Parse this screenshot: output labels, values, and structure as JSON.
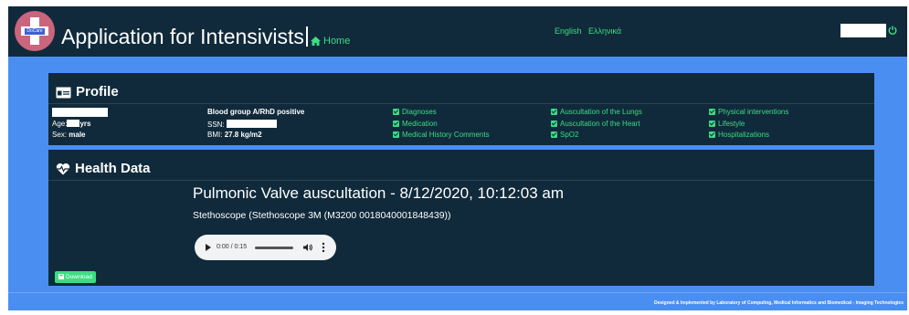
{
  "header": {
    "app_title": "Application for Intensivists",
    "home_label": "Home",
    "languages": [
      "English",
      "Ελληνικά"
    ],
    "logo_tag": "DoCare"
  },
  "profile": {
    "heading": "Profile",
    "age_label": "Age:",
    "age_unit": "yrs",
    "sex_label": "Sex:",
    "sex_value": "male",
    "blood_group": "Blood group A/RhD positive",
    "ssn_label": "SSN:",
    "bmi_label": "BMI:",
    "bmi_value": "27.8 kg/m2",
    "links_col1": [
      "Diagnoses",
      "Medication",
      "Medical History Comments"
    ],
    "links_col2": [
      "Auscultation of the Lungs",
      "Auscultation of the Heart",
      "SpO2"
    ],
    "links_col3": [
      "Physical interventions",
      "Lifestyle",
      "Hospitalizations"
    ]
  },
  "health": {
    "heading": "Health Data",
    "record_title": "Pulmonic Valve auscultation - 8/12/2020, 10:12:03 am",
    "device": "Stethoscope (Stethoscope 3M (M3200 0018040001848439))",
    "audio_time": "0:00 / 0:15",
    "download_label": "Download"
  },
  "footer": {
    "credit": "Designed & Implemented by Laboratory of Computing, Medical Informatics and Biomedical - Imaging Technologies"
  },
  "colors": {
    "accent_green": "#3ddc84",
    "panel_bg": "#102a3b",
    "page_bg": "#4a8ef2"
  }
}
